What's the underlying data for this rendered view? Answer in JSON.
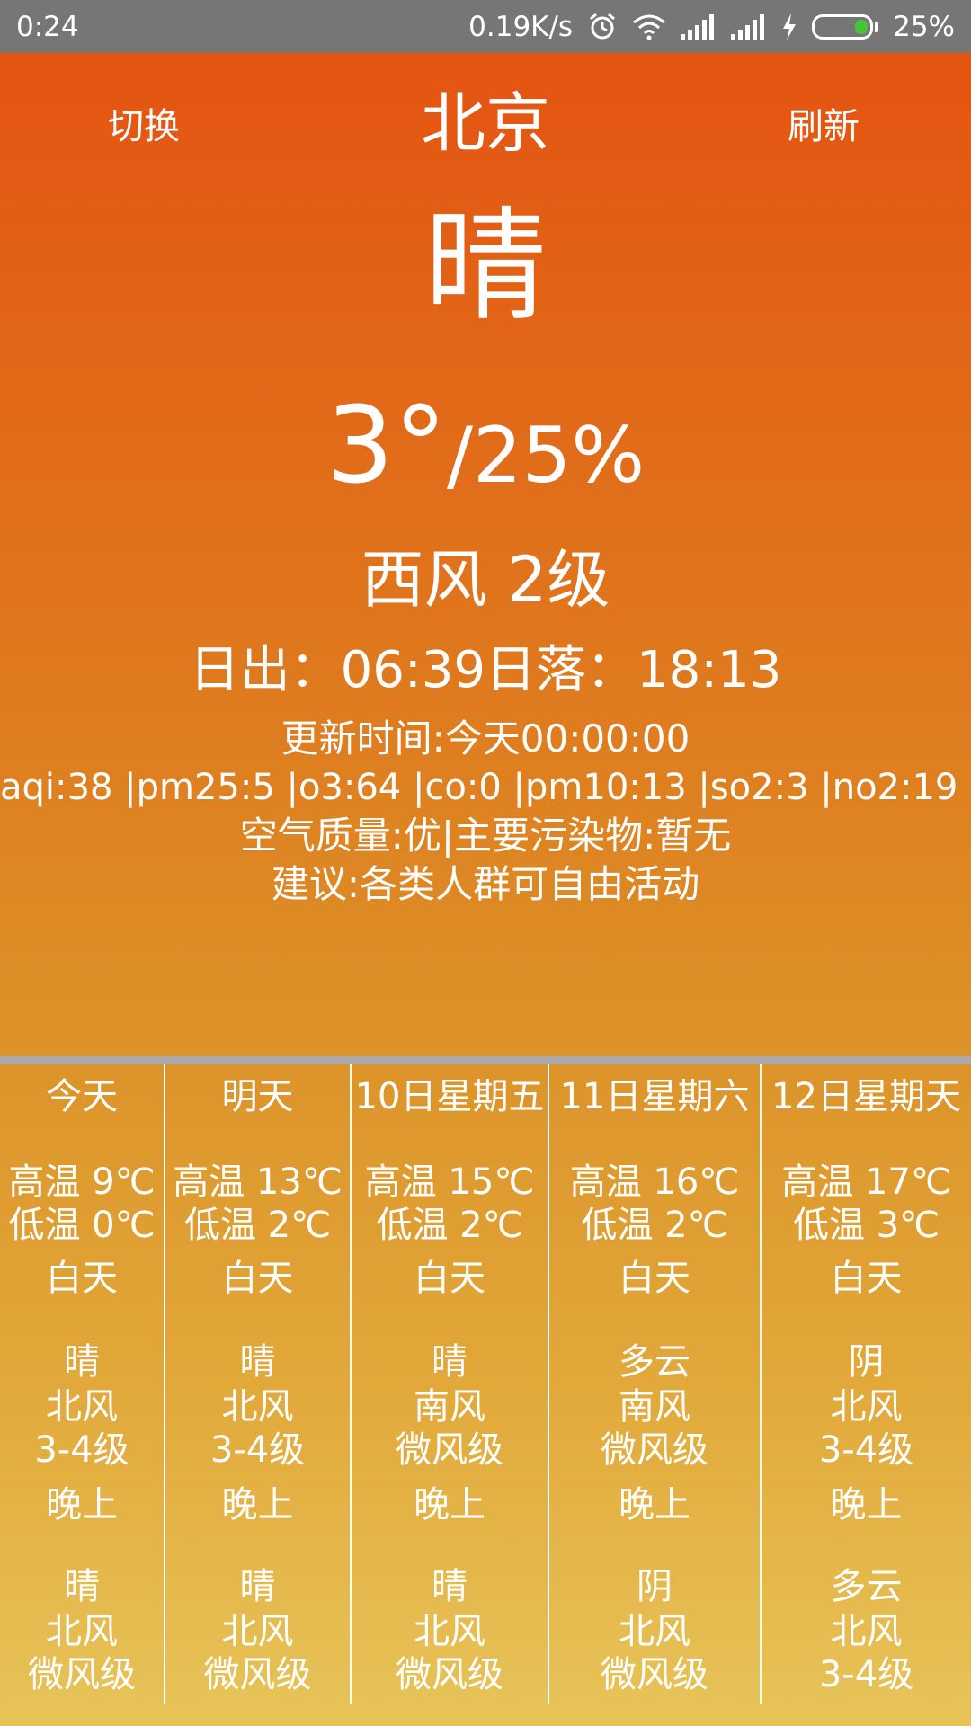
{
  "status_bar": {
    "time": "0:24",
    "net_speed": "0.19K/s",
    "battery_percent": "25%",
    "battery_level": 0.25,
    "icons": [
      "alarm-icon",
      "wifi-icon",
      "signal-icon",
      "signal-icon",
      "charging-icon",
      "battery-icon"
    ]
  },
  "header": {
    "switch_label": "切换",
    "city": "北京",
    "refresh_label": "刷新"
  },
  "current": {
    "condition": "晴",
    "temp": "3°",
    "humidity": "/25%",
    "wind": "西风 2级",
    "sun": "日出：06:39日落：18:13",
    "update_time": "更新时间:今天00:00:00",
    "aqi_line": "aqi:38 |pm25:5 |o3:64 |co:0 |pm10:13 |so2:3 |no2:19 |",
    "quality": "空气质量:优|主要污染物:暂无",
    "advice": "建议:各类人群可自由活动"
  },
  "forecast": [
    {
      "day": "今天",
      "high": "高温 9℃",
      "low": "低温 0℃",
      "day_label": "白天",
      "day_weather": "晴",
      "day_wind": "北风",
      "day_level": "3-4级",
      "night_label": "晚上",
      "night_weather": "晴",
      "night_wind": "北风",
      "night_level": "微风级"
    },
    {
      "day": "明天",
      "high": "高温 13℃",
      "low": "低温 2℃",
      "day_label": "白天",
      "day_weather": "晴",
      "day_wind": "北风",
      "day_level": "3-4级",
      "night_label": "晚上",
      "night_weather": "晴",
      "night_wind": "北风",
      "night_level": "微风级"
    },
    {
      "day": "10日星期五",
      "high": "高温 15℃",
      "low": "低温 2℃",
      "day_label": "白天",
      "day_weather": "晴",
      "day_wind": "南风",
      "day_level": "微风级",
      "night_label": "晚上",
      "night_weather": "晴",
      "night_wind": "北风",
      "night_level": "微风级"
    },
    {
      "day": "11日星期六",
      "high": "高温 16℃",
      "low": "低温 2℃",
      "day_label": "白天",
      "day_weather": "多云",
      "day_wind": "南风",
      "day_level": "微风级",
      "night_label": "晚上",
      "night_weather": "阴",
      "night_wind": "北风",
      "night_level": "微风级"
    },
    {
      "day": "12日星期天",
      "high": "高温 17℃",
      "low": "低温 3℃",
      "day_label": "白天",
      "day_weather": "阴",
      "day_wind": "北风",
      "day_level": "3-4级",
      "night_label": "晚上",
      "night_weather": "多云",
      "night_wind": "北风",
      "night_level": "3-4级"
    }
  ]
}
